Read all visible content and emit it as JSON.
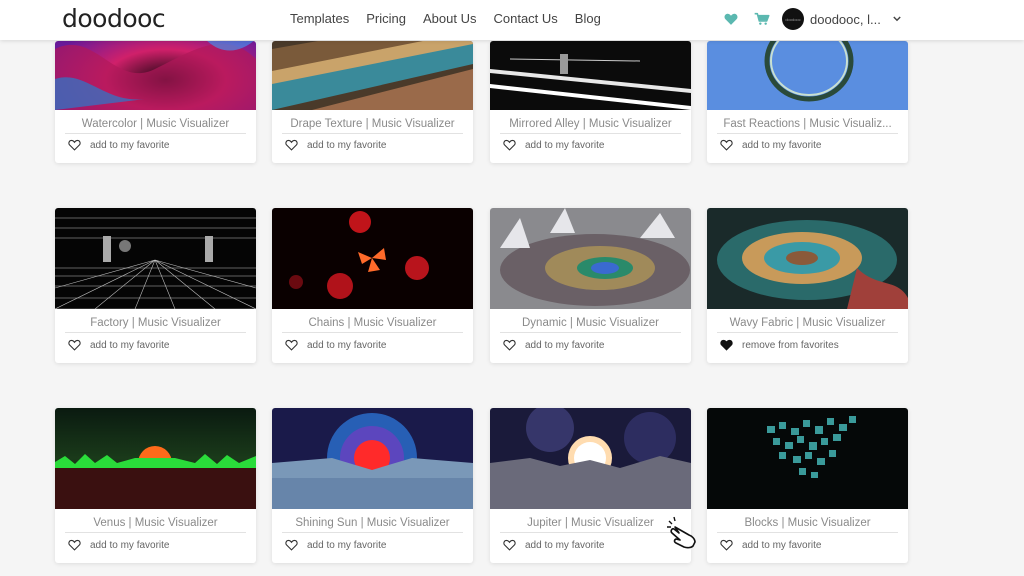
{
  "header": {
    "logo": "doodooc",
    "nav": [
      "Templates",
      "Pricing",
      "About Us",
      "Contact Us",
      "Blog"
    ],
    "user_name": "doodooc, l...",
    "avatar_text": "doodooc",
    "accent_color": "#5bb8b0"
  },
  "cards": [
    {
      "title": "Watercolor | Music Visualizer",
      "fav": "add to my favorite",
      "favorited": false
    },
    {
      "title": "Drape Texture | Music Visualizer",
      "fav": "add to my favorite",
      "favorited": false
    },
    {
      "title": "Mirrored Alley | Music Visualizer",
      "fav": "add to my favorite",
      "favorited": false
    },
    {
      "title": "Fast Reactions | Music Visualiz...",
      "fav": "add to my favorite",
      "favorited": false
    },
    {
      "title": "Factory | Music Visualizer",
      "fav": "add to my favorite",
      "favorited": false
    },
    {
      "title": "Chains | Music Visualizer",
      "fav": "add to my favorite",
      "favorited": false
    },
    {
      "title": "Dynamic | Music Visualizer",
      "fav": "add to my favorite",
      "favorited": false
    },
    {
      "title": "Wavy Fabric | Music Visualizer",
      "fav": "remove from favorites",
      "favorited": true
    },
    {
      "title": "Venus | Music Visualizer",
      "fav": "add to my favorite",
      "favorited": false
    },
    {
      "title": "Shining Sun | Music Visualizer",
      "fav": "add to my favorite",
      "favorited": false
    },
    {
      "title": "Jupiter | Music Visualizer",
      "fav": "add to my favorite",
      "favorited": false
    },
    {
      "title": "Blocks | Music Visualizer",
      "fav": "add to my favorite",
      "favorited": false
    }
  ]
}
